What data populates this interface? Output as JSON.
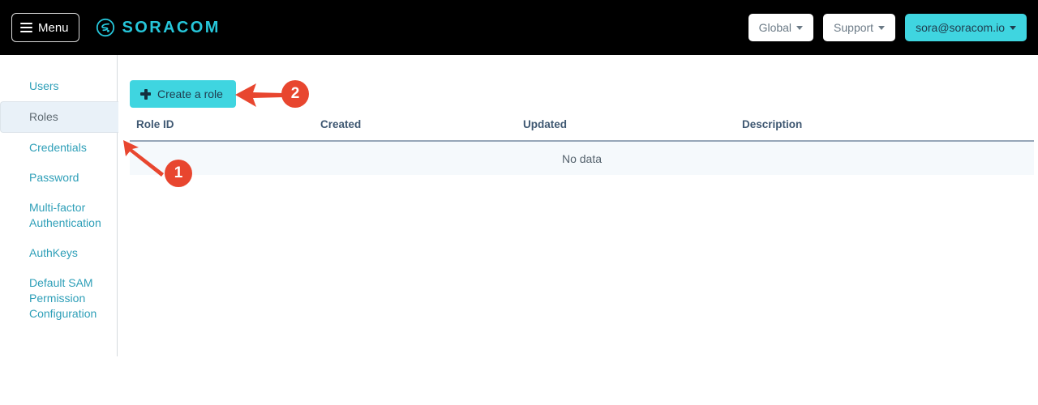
{
  "header": {
    "menu_label": "Menu",
    "menu_icon": "hamburger-icon",
    "brand_name": "SORACOM",
    "brand_icon": "soracom-logo-icon",
    "region_label": "Global",
    "support_label": "Support",
    "account_label": "sora@soracom.io",
    "caret_icon": "chevron-down-icon",
    "background_color": "#000000",
    "accent_color": "#3fd5e0"
  },
  "sidebar": {
    "items": [
      {
        "label": "Users",
        "active": false
      },
      {
        "label": "Roles",
        "active": true
      },
      {
        "label": "Credentials",
        "active": false
      },
      {
        "label": "Password",
        "active": false
      },
      {
        "label": "Multi-factor Authentication",
        "active": false
      },
      {
        "label": "AuthKeys",
        "active": false
      },
      {
        "label": "Default SAM Permission Configuration",
        "active": false
      }
    ],
    "link_color": "#2e9fb8",
    "active_bg": "#e9f1f8"
  },
  "main": {
    "create_button_label": "Create a role",
    "create_button_icon": "plus-icon",
    "table": {
      "columns": [
        "Role ID",
        "Created",
        "Updated",
        "Description"
      ],
      "rows": [],
      "empty_message": "No data"
    }
  },
  "annotations": [
    {
      "number": "1",
      "arrow": "diagonal-up-left",
      "target": "role-id-column-header"
    },
    {
      "number": "2",
      "arrow": "left",
      "target": "create-a-role-button"
    }
  ]
}
